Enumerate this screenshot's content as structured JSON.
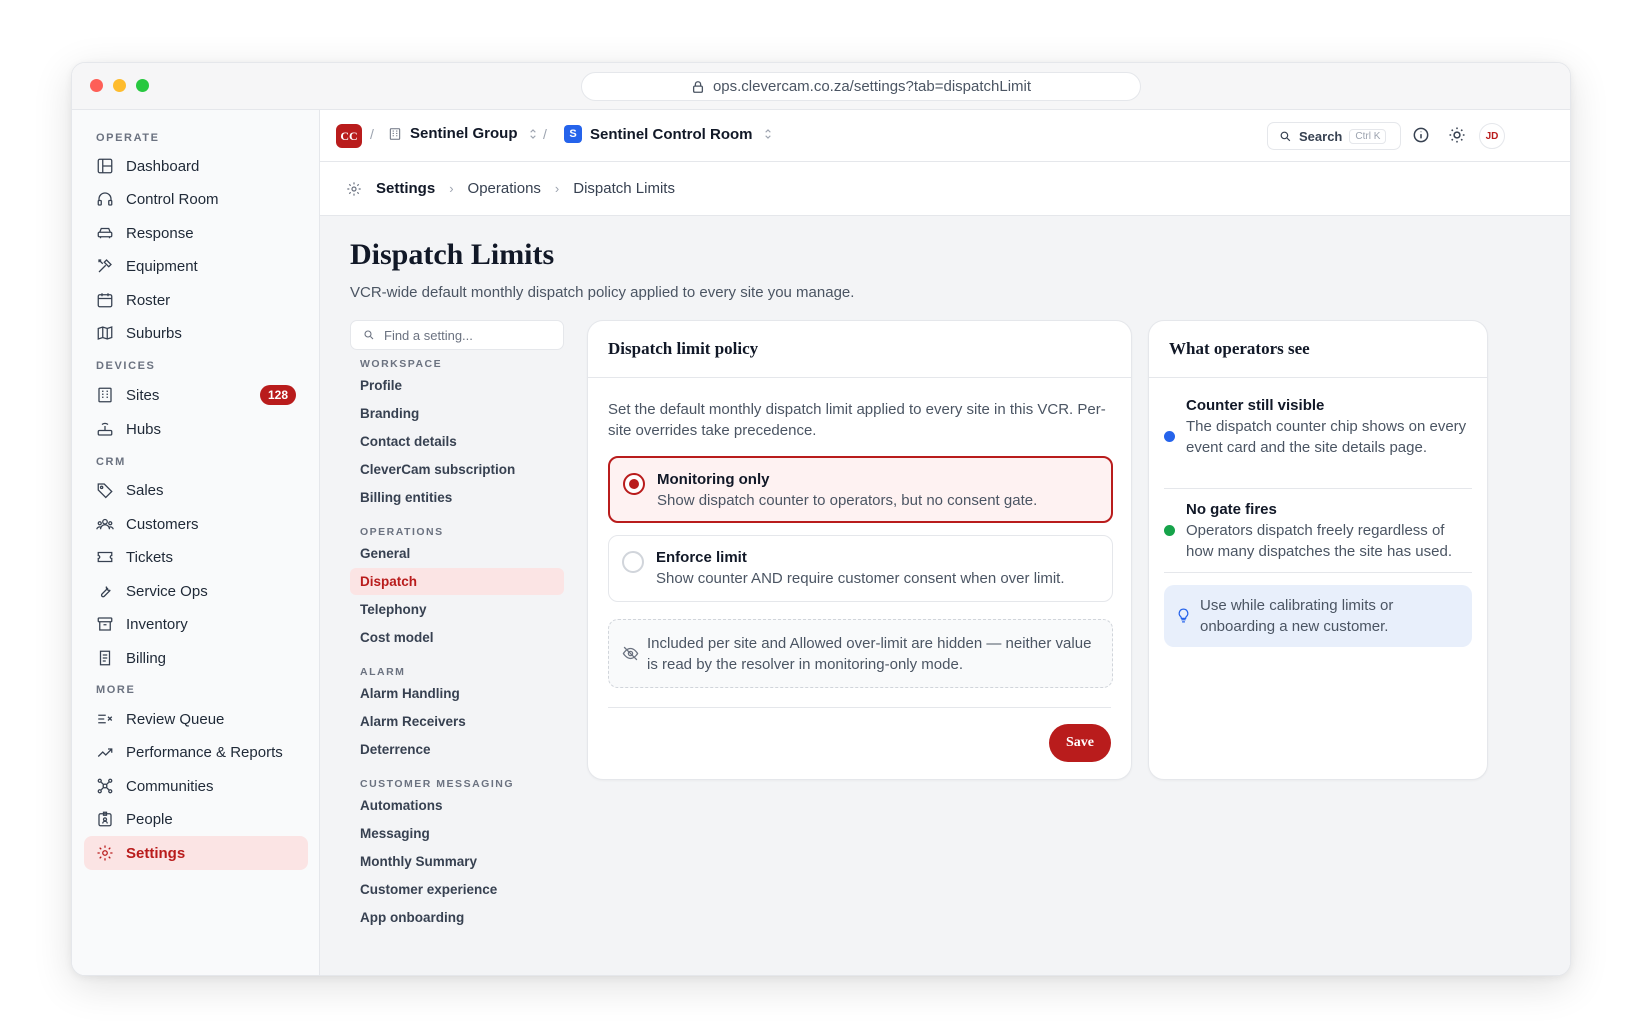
{
  "browser": {
    "url": "ops.clevercam.co.za/settings?tab=dispatchLimit"
  },
  "sidebar": {
    "sections": {
      "operate": "OPERATE",
      "devices": "DEVICES",
      "crm": "CRM",
      "more": "MORE"
    },
    "items": {
      "dashboard": "Dashboard",
      "control_room": "Control Room",
      "response": "Response",
      "equipment": "Equipment",
      "roster": "Roster",
      "suburbs": "Suburbs",
      "sites": "Sites",
      "sites_badge": "128",
      "hubs": "Hubs",
      "sales": "Sales",
      "customers": "Customers",
      "tickets": "Tickets",
      "service_ops": "Service Ops",
      "inventory": "Inventory",
      "billing": "Billing",
      "review_queue": "Review Queue",
      "performance": "Performance & Reports",
      "communities": "Communities",
      "people": "People",
      "settings": "Settings"
    }
  },
  "topbar": {
    "logo": "CC",
    "sep": "/",
    "org": "Sentinel Group",
    "room_chip": "S",
    "room": "Sentinel Control Room",
    "search_label": "Search",
    "search_kbd": "Ctrl K",
    "avatar": "JD"
  },
  "breadcrumb": {
    "first": "Settings",
    "second": "Operations",
    "third": "Dispatch Limits",
    "chev": "›"
  },
  "page": {
    "title": "Dispatch Limits",
    "subtitle": "VCR-wide default monthly dispatch policy applied to every site you manage."
  },
  "settings_nav": {
    "find_placeholder": "Find a setting...",
    "sections": {
      "workspace": "WORKSPACE",
      "operations": "OPERATIONS",
      "alarm": "ALARM",
      "customer_messaging": "CUSTOMER MESSAGING"
    },
    "items": {
      "profile": "Profile",
      "branding": "Branding",
      "contact_details": "Contact details",
      "subscription": "CleverCam subscription",
      "billing_entities": "Billing entities",
      "general": "General",
      "dispatch": "Dispatch",
      "telephony": "Telephony",
      "cost_model": "Cost model",
      "alarm_handling": "Alarm Handling",
      "alarm_receivers": "Alarm Receivers",
      "deterrence": "Deterrence",
      "automations": "Automations",
      "messaging": "Messaging",
      "monthly_summary": "Monthly Summary",
      "customer_experience": "Customer experience",
      "app_onboarding": "App onboarding"
    }
  },
  "policy_card": {
    "title": "Dispatch limit policy",
    "intro": "Set the default monthly dispatch limit applied to every site in this VCR. Per-site overrides take precedence.",
    "options": [
      {
        "title": "Monitoring only",
        "desc": "Show dispatch counter to operators, but no consent gate.",
        "selected": true
      },
      {
        "title": "Enforce limit",
        "desc": "Show counter AND require customer consent when over limit.",
        "selected": false
      }
    ],
    "hidden_note": "Included per site and Allowed over-limit are hidden — neither value is read by the resolver in monitoring-only mode.",
    "save_label": "Save"
  },
  "ops_card": {
    "title": "What operators see",
    "items": [
      {
        "title": "Counter still visible",
        "desc": "The dispatch counter chip shows on every event card and the site details page.",
        "color": "#2563eb"
      },
      {
        "title": "No gate fires",
        "desc": "Operators dispatch freely regardless of how many dispatches the site has used.",
        "color": "#16a34a"
      }
    ],
    "tip": "Use while calibrating limits or onboarding a new customer."
  },
  "colors": {
    "accent": "#b91c1c",
    "accent_soft": "#fbe4e4",
    "info": "#2563eb",
    "success": "#16a34a"
  }
}
